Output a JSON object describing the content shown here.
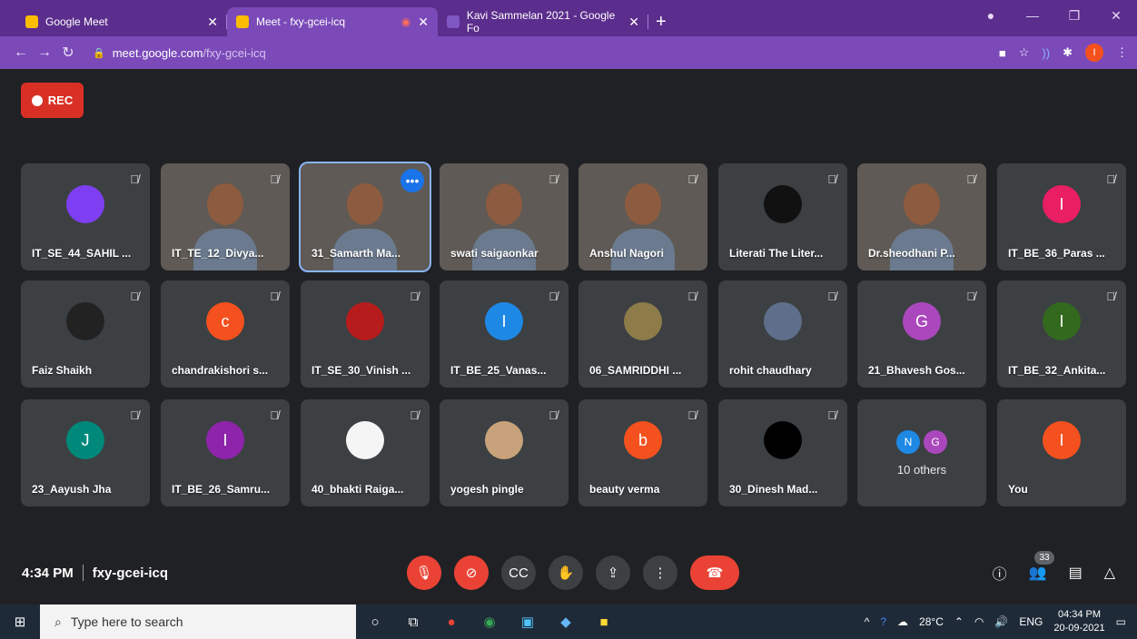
{
  "browser": {
    "tabs": [
      {
        "title": "Google Meet",
        "active": false
      },
      {
        "title": "Meet - fxy-gcei-icq",
        "active": true
      },
      {
        "title": "Kavi Sammelan 2021 - Google Fo",
        "active": false
      }
    ],
    "url_domain": "meet.google.com",
    "url_path": "/fxy-gcei-icq",
    "profile_initial": "I"
  },
  "recording": {
    "label": "REC"
  },
  "participants": [
    {
      "name": "IT_SE_44_SAHIL ...",
      "type": "avatar-img",
      "color": "#7e3ff2"
    },
    {
      "name": "IT_TE_12_Divya...",
      "type": "video"
    },
    {
      "name": "31_Samarth Ma...",
      "type": "video",
      "speaking": true
    },
    {
      "name": "swati saigaonkar",
      "type": "video"
    },
    {
      "name": "Anshul Nagori",
      "type": "video"
    },
    {
      "name": "Literati The Liter...",
      "type": "avatar-img",
      "color": "#111111"
    },
    {
      "name": "Dr.sheodhani P...",
      "type": "video"
    },
    {
      "name": "IT_BE_36_Paras ...",
      "type": "letter",
      "letter": "I",
      "color": "#e91e63"
    },
    {
      "name": "Faiz Shaikh",
      "type": "avatar-img",
      "color": "#222222"
    },
    {
      "name": "chandrakishori s...",
      "type": "letter",
      "letter": "c",
      "color": "#f4511e"
    },
    {
      "name": "IT_SE_30_Vinish ...",
      "type": "avatar-img",
      "color": "#b71c1c"
    },
    {
      "name": "IT_BE_25_Vanas...",
      "type": "letter",
      "letter": "I",
      "color": "#1e88e5"
    },
    {
      "name": "06_SAMRIDDHI ...",
      "type": "avatar-img",
      "color": "#8d7b4a"
    },
    {
      "name": "rohit chaudhary",
      "type": "avatar-img",
      "color": "#5d6f8a"
    },
    {
      "name": "21_Bhavesh Gos...",
      "type": "letter",
      "letter": "G",
      "color": "#ab47bc"
    },
    {
      "name": "IT_BE_32_Ankita...",
      "type": "letter",
      "letter": "I",
      "color": "#33691e"
    },
    {
      "name": "23_Aayush Jha",
      "type": "letter",
      "letter": "J",
      "color": "#00897b"
    },
    {
      "name": "IT_BE_26_Samru...",
      "type": "letter",
      "letter": "I",
      "color": "#8e24aa"
    },
    {
      "name": "40_bhakti Raiga...",
      "type": "avatar-img",
      "color": "#f5f5f5"
    },
    {
      "name": "yogesh pingle",
      "type": "avatar-img",
      "color": "#c8a27a"
    },
    {
      "name": "beauty verma",
      "type": "letter",
      "letter": "b",
      "color": "#f4511e"
    },
    {
      "name": "30_Dinesh Mad...",
      "type": "avatar-img",
      "color": "#000000"
    },
    {
      "name": "10 others",
      "type": "others",
      "mini": [
        {
          "letter": "N",
          "color": "#1e88e5"
        },
        {
          "letter": "G",
          "color": "#ab47bc"
        }
      ]
    },
    {
      "name": "You",
      "type": "letter",
      "letter": "I",
      "color": "#f4511e"
    }
  ],
  "meeting": {
    "time": "4:34 PM",
    "code": "fxy-gcei-icq",
    "participant_count": "33"
  },
  "taskbar": {
    "search_placeholder": "Type here to search",
    "weather": "28°C",
    "lang": "ENG",
    "time": "04:34 PM",
    "date": "20-09-2021"
  }
}
